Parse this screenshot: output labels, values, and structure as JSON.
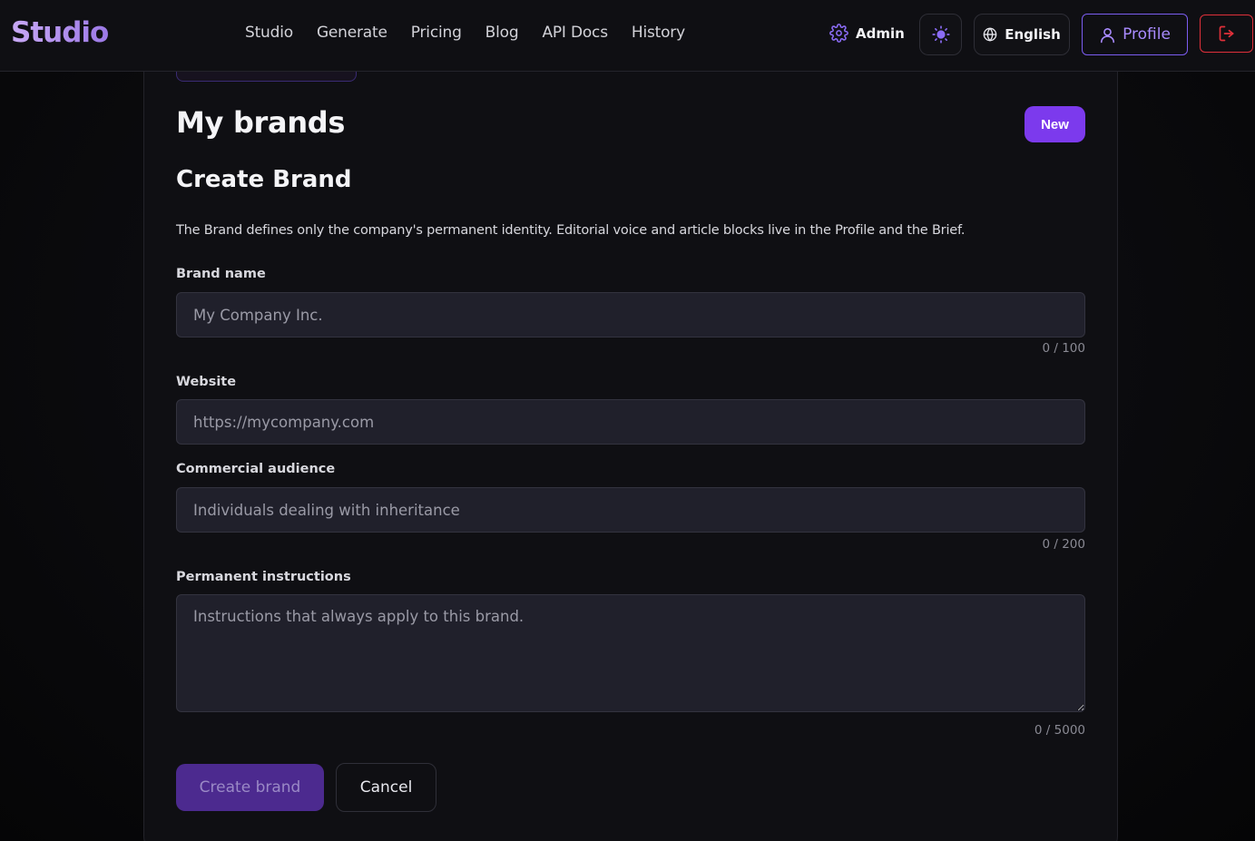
{
  "header": {
    "logo": "Studio",
    "nav": [
      "Studio",
      "Generate",
      "Pricing",
      "Blog",
      "API Docs",
      "History"
    ],
    "admin_label": "Admin",
    "language_label": "English",
    "profile_label": "Profile",
    "icons": {
      "admin": "gear-icon",
      "theme": "sun-icon",
      "language": "globe-icon",
      "profile": "user-icon",
      "logout": "logout-icon"
    },
    "colors": {
      "accent": "#7c3aed",
      "logout": "#e0303a"
    }
  },
  "page": {
    "title": "My brands",
    "new_button": "New",
    "section_title": "Create Brand",
    "description": "The Brand defines only the company's permanent identity. Editorial voice and article blocks live in the Profile and the Brief."
  },
  "form": {
    "brand_name": {
      "label": "Brand name",
      "value": "",
      "placeholder": "My Company Inc.",
      "counter": "0 / 100"
    },
    "website": {
      "label": "Website",
      "value": "",
      "placeholder": "https://mycompany.com"
    },
    "audience": {
      "label": "Commercial audience",
      "value": "",
      "placeholder": "Individuals dealing with inheritance",
      "counter": "0 / 200"
    },
    "instructions": {
      "label": "Permanent instructions",
      "value": "",
      "placeholder": "Instructions that always apply to this brand.",
      "counter": "0 / 5000"
    },
    "create_button": "Create brand",
    "cancel_button": "Cancel"
  }
}
